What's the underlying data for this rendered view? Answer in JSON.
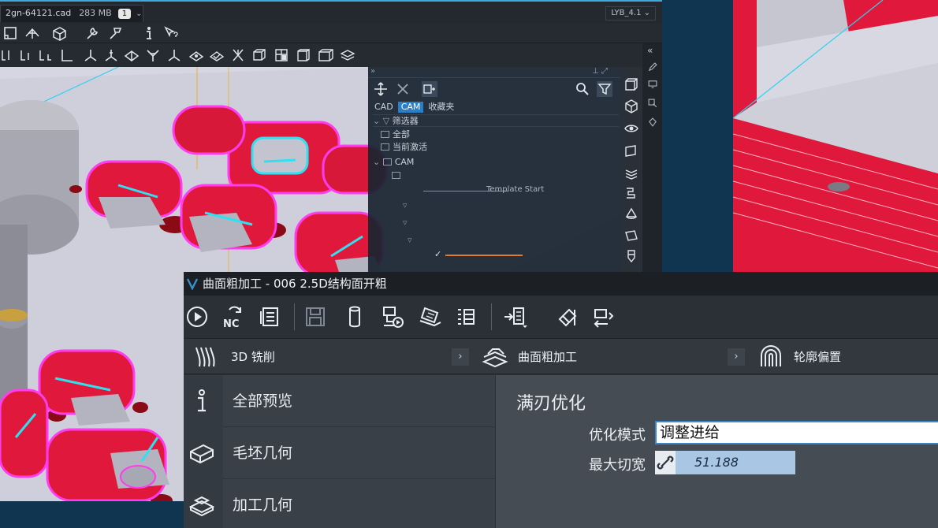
{
  "main_window": {
    "file_tab": {
      "name": "2gn-64121.cad",
      "size": "283 MB",
      "count": "1"
    },
    "layout_selector": "LYB_4.1",
    "toolbar1_icons": [
      "frame-icon",
      "view-orient-icon",
      "box-view-icon",
      "wrench-icon",
      "tool-holder-icon",
      "info-icon",
      "pointer-help-icon"
    ],
    "toolbar2_icons": [
      "dim-1-icon",
      "dim-2-icon",
      "dim-3-icon",
      "axis-l-icon",
      "axis-y-icon",
      "axis-tri-icon",
      "plane-icon",
      "star-axis-icon",
      "axis-y2-icon",
      "eye-plane-icon",
      "plane-check-icon",
      "cross-axis-icon",
      "cube-a-icon",
      "cube-b-icon",
      "cube-c-icon",
      "cube-d-icon",
      "stack-icon"
    ]
  },
  "tree_panel": {
    "tabs": [
      "CAD",
      "CAM",
      "收藏夹"
    ],
    "active_tab": "CAM",
    "filter_label": "筛选器",
    "rows": [
      "全部",
      "当前激活",
      "CAM"
    ],
    "template_label": "Template Start"
  },
  "side_strip_icons": [
    "cube-front-icon",
    "cube-iso-icon",
    "eye-icon",
    "face-icon",
    "layers-icon",
    "tool-path-icon",
    "cone-icon",
    "slab-icon",
    "cutter-icon"
  ],
  "dialog": {
    "title": "曲面粗加工 - 006 2.5D结构面开粗",
    "toolbar_icons": [
      "play-icon",
      "nc-regenerate-icon",
      "sheet-icon",
      "save-icon",
      "cylinder-icon",
      "machine-simulate-icon",
      "laptop-icon",
      "list-icon",
      "import-list-icon",
      "eraser-icon",
      "transform-icon"
    ],
    "nc_text": "NC",
    "breadcrumb": [
      {
        "label": "3D 铣削",
        "icon": "mill-3d-icon"
      },
      {
        "label": "曲面粗加工",
        "icon": "surface-rough-icon"
      },
      {
        "label": "轮廓偏置",
        "icon": "contour-offset-icon"
      }
    ],
    "nav": [
      {
        "label": "全部预览",
        "icon": "info-icon"
      },
      {
        "label": "毛坯几何",
        "icon": "stock-box-icon"
      },
      {
        "label": "加工几何",
        "icon": "part-geometry-icon"
      }
    ],
    "section_title": "满刃优化",
    "params": {
      "mode_label": "优化模式",
      "mode_value": "调整进给",
      "max_cut_label": "最大切宽",
      "max_cut_value": "51.188"
    }
  },
  "colors": {
    "accent": "#2c7ec7",
    "toolpath_red": "#e0193c",
    "toolpath_magenta": "#ff3cf0",
    "toolpath_cyan": "#2fe0f0",
    "toolpath_yellow": "#e8b020",
    "dialog_bg": "#2b3036"
  }
}
